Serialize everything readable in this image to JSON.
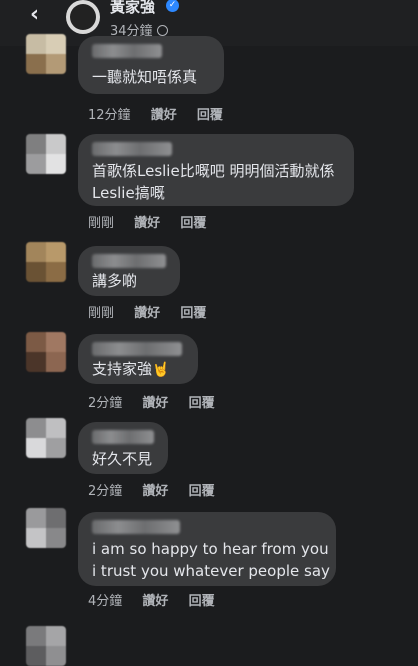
{
  "header": {
    "back_icon": "chevron-left-icon",
    "poster_name": "黃家強",
    "post_time": "34分鐘",
    "privacy_icon": "globe-icon",
    "verified_icon": "verified-badge-icon"
  },
  "colors": {
    "background": "#1b1c1e",
    "bubble": "#3a3b3d",
    "text": "#e4e6eb",
    "secondary_text": "#b0b3b8",
    "verified": "#2d88ff"
  },
  "comments": [
    {
      "text_lines": [
        "一聽就知唔係真"
      ],
      "time": "12分鐘",
      "like": "讚好",
      "reply": "回覆"
    },
    {
      "text_lines": [
        "首歌係Leslie比嘅吧 明明個活動就係",
        "Leslie搞嘅"
      ],
      "time": "剛剛",
      "like": "讚好",
      "reply": "回覆"
    },
    {
      "text_lines": [
        "講多啲"
      ],
      "time": "剛剛",
      "like": "讚好",
      "reply": "回覆"
    },
    {
      "text_lines": [
        "支持家強"
      ],
      "emoji": "🤘",
      "time": "2分鐘",
      "like": "讚好",
      "reply": "回覆"
    },
    {
      "text_lines": [
        "好久不見"
      ],
      "time": "2分鐘",
      "like": "讚好",
      "reply": "回覆"
    },
    {
      "text_lines": [
        "i am so happy to hear from you",
        "i trust you whatever people say"
      ],
      "time": "4分鐘",
      "like": "讚好",
      "reply": "回覆"
    }
  ]
}
